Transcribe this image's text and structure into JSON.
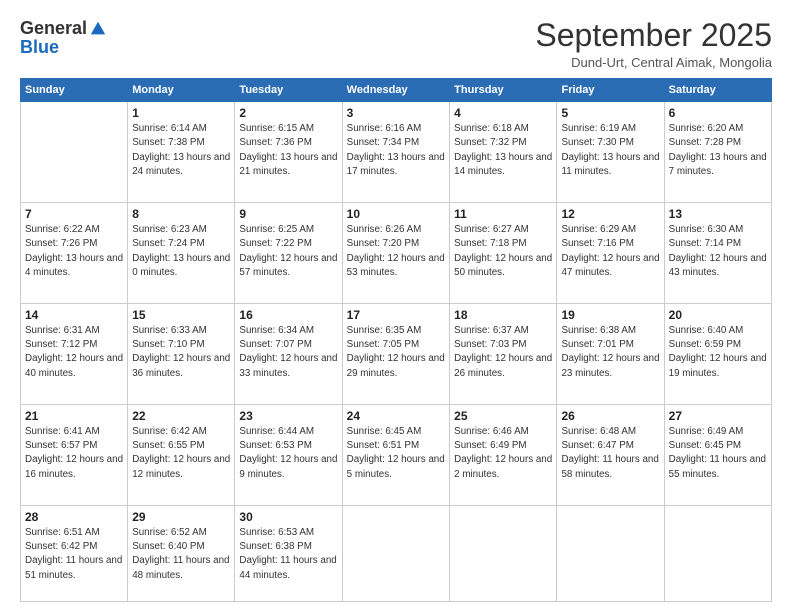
{
  "logo": {
    "general": "General",
    "blue": "Blue"
  },
  "header": {
    "month": "September 2025",
    "location": "Dund-Urt, Central Aimak, Mongolia"
  },
  "weekdays": [
    "Sunday",
    "Monday",
    "Tuesday",
    "Wednesday",
    "Thursday",
    "Friday",
    "Saturday"
  ],
  "weeks": [
    [
      {
        "day": "",
        "sunrise": "",
        "sunset": "",
        "daylight": ""
      },
      {
        "day": "1",
        "sunrise": "Sunrise: 6:14 AM",
        "sunset": "Sunset: 7:38 PM",
        "daylight": "Daylight: 13 hours and 24 minutes."
      },
      {
        "day": "2",
        "sunrise": "Sunrise: 6:15 AM",
        "sunset": "Sunset: 7:36 PM",
        "daylight": "Daylight: 13 hours and 21 minutes."
      },
      {
        "day": "3",
        "sunrise": "Sunrise: 6:16 AM",
        "sunset": "Sunset: 7:34 PM",
        "daylight": "Daylight: 13 hours and 17 minutes."
      },
      {
        "day": "4",
        "sunrise": "Sunrise: 6:18 AM",
        "sunset": "Sunset: 7:32 PM",
        "daylight": "Daylight: 13 hours and 14 minutes."
      },
      {
        "day": "5",
        "sunrise": "Sunrise: 6:19 AM",
        "sunset": "Sunset: 7:30 PM",
        "daylight": "Daylight: 13 hours and 11 minutes."
      },
      {
        "day": "6",
        "sunrise": "Sunrise: 6:20 AM",
        "sunset": "Sunset: 7:28 PM",
        "daylight": "Daylight: 13 hours and 7 minutes."
      }
    ],
    [
      {
        "day": "7",
        "sunrise": "Sunrise: 6:22 AM",
        "sunset": "Sunset: 7:26 PM",
        "daylight": "Daylight: 13 hours and 4 minutes."
      },
      {
        "day": "8",
        "sunrise": "Sunrise: 6:23 AM",
        "sunset": "Sunset: 7:24 PM",
        "daylight": "Daylight: 13 hours and 0 minutes."
      },
      {
        "day": "9",
        "sunrise": "Sunrise: 6:25 AM",
        "sunset": "Sunset: 7:22 PM",
        "daylight": "Daylight: 12 hours and 57 minutes."
      },
      {
        "day": "10",
        "sunrise": "Sunrise: 6:26 AM",
        "sunset": "Sunset: 7:20 PM",
        "daylight": "Daylight: 12 hours and 53 minutes."
      },
      {
        "day": "11",
        "sunrise": "Sunrise: 6:27 AM",
        "sunset": "Sunset: 7:18 PM",
        "daylight": "Daylight: 12 hours and 50 minutes."
      },
      {
        "day": "12",
        "sunrise": "Sunrise: 6:29 AM",
        "sunset": "Sunset: 7:16 PM",
        "daylight": "Daylight: 12 hours and 47 minutes."
      },
      {
        "day": "13",
        "sunrise": "Sunrise: 6:30 AM",
        "sunset": "Sunset: 7:14 PM",
        "daylight": "Daylight: 12 hours and 43 minutes."
      }
    ],
    [
      {
        "day": "14",
        "sunrise": "Sunrise: 6:31 AM",
        "sunset": "Sunset: 7:12 PM",
        "daylight": "Daylight: 12 hours and 40 minutes."
      },
      {
        "day": "15",
        "sunrise": "Sunrise: 6:33 AM",
        "sunset": "Sunset: 7:10 PM",
        "daylight": "Daylight: 12 hours and 36 minutes."
      },
      {
        "day": "16",
        "sunrise": "Sunrise: 6:34 AM",
        "sunset": "Sunset: 7:07 PM",
        "daylight": "Daylight: 12 hours and 33 minutes."
      },
      {
        "day": "17",
        "sunrise": "Sunrise: 6:35 AM",
        "sunset": "Sunset: 7:05 PM",
        "daylight": "Daylight: 12 hours and 29 minutes."
      },
      {
        "day": "18",
        "sunrise": "Sunrise: 6:37 AM",
        "sunset": "Sunset: 7:03 PM",
        "daylight": "Daylight: 12 hours and 26 minutes."
      },
      {
        "day": "19",
        "sunrise": "Sunrise: 6:38 AM",
        "sunset": "Sunset: 7:01 PM",
        "daylight": "Daylight: 12 hours and 23 minutes."
      },
      {
        "day": "20",
        "sunrise": "Sunrise: 6:40 AM",
        "sunset": "Sunset: 6:59 PM",
        "daylight": "Daylight: 12 hours and 19 minutes."
      }
    ],
    [
      {
        "day": "21",
        "sunrise": "Sunrise: 6:41 AM",
        "sunset": "Sunset: 6:57 PM",
        "daylight": "Daylight: 12 hours and 16 minutes."
      },
      {
        "day": "22",
        "sunrise": "Sunrise: 6:42 AM",
        "sunset": "Sunset: 6:55 PM",
        "daylight": "Daylight: 12 hours and 12 minutes."
      },
      {
        "day": "23",
        "sunrise": "Sunrise: 6:44 AM",
        "sunset": "Sunset: 6:53 PM",
        "daylight": "Daylight: 12 hours and 9 minutes."
      },
      {
        "day": "24",
        "sunrise": "Sunrise: 6:45 AM",
        "sunset": "Sunset: 6:51 PM",
        "daylight": "Daylight: 12 hours and 5 minutes."
      },
      {
        "day": "25",
        "sunrise": "Sunrise: 6:46 AM",
        "sunset": "Sunset: 6:49 PM",
        "daylight": "Daylight: 12 hours and 2 minutes."
      },
      {
        "day": "26",
        "sunrise": "Sunrise: 6:48 AM",
        "sunset": "Sunset: 6:47 PM",
        "daylight": "Daylight: 11 hours and 58 minutes."
      },
      {
        "day": "27",
        "sunrise": "Sunrise: 6:49 AM",
        "sunset": "Sunset: 6:45 PM",
        "daylight": "Daylight: 11 hours and 55 minutes."
      }
    ],
    [
      {
        "day": "28",
        "sunrise": "Sunrise: 6:51 AM",
        "sunset": "Sunset: 6:42 PM",
        "daylight": "Daylight: 11 hours and 51 minutes."
      },
      {
        "day": "29",
        "sunrise": "Sunrise: 6:52 AM",
        "sunset": "Sunset: 6:40 PM",
        "daylight": "Daylight: 11 hours and 48 minutes."
      },
      {
        "day": "30",
        "sunrise": "Sunrise: 6:53 AM",
        "sunset": "Sunset: 6:38 PM",
        "daylight": "Daylight: 11 hours and 44 minutes."
      },
      {
        "day": "",
        "sunrise": "",
        "sunset": "",
        "daylight": ""
      },
      {
        "day": "",
        "sunrise": "",
        "sunset": "",
        "daylight": ""
      },
      {
        "day": "",
        "sunrise": "",
        "sunset": "",
        "daylight": ""
      },
      {
        "day": "",
        "sunrise": "",
        "sunset": "",
        "daylight": ""
      }
    ]
  ]
}
